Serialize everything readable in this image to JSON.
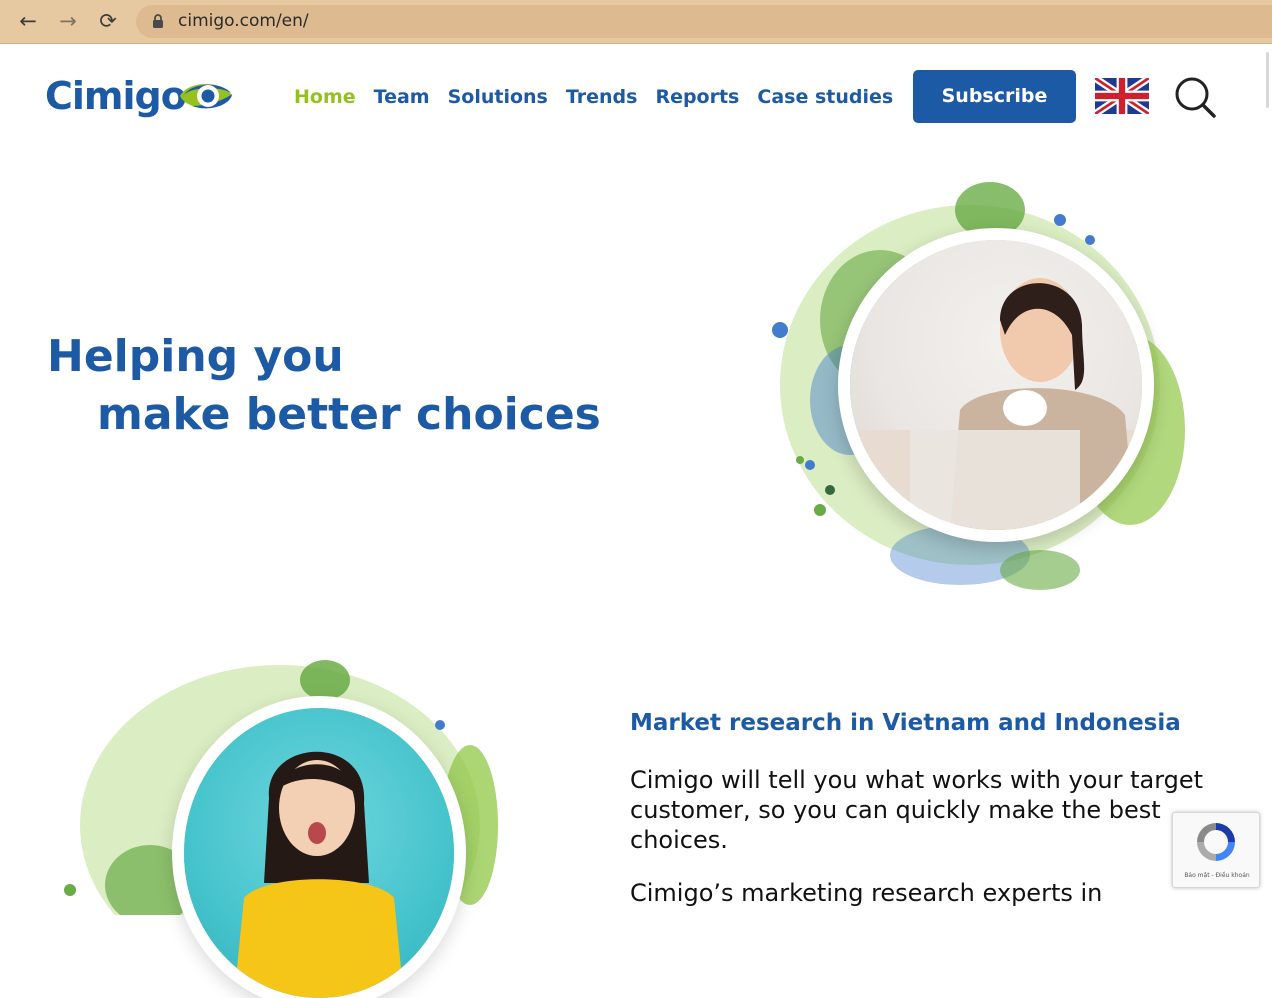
{
  "browser": {
    "url": "cimigo.com/en/",
    "icons": {
      "back": "back-arrow-icon",
      "forward": "forward-arrow-icon",
      "reload": "reload-icon",
      "lock": "lock-icon"
    }
  },
  "header": {
    "logo_text": "Cimigo",
    "nav": [
      {
        "label": "Home",
        "active": true
      },
      {
        "label": "Team",
        "active": false
      },
      {
        "label": "Solutions",
        "active": false
      },
      {
        "label": "Trends",
        "active": false
      },
      {
        "label": "Reports",
        "active": false
      },
      {
        "label": "Case studies",
        "active": false
      }
    ],
    "subscribe_label": "Subscribe",
    "language_icon": "uk-flag-icon",
    "search_icon": "search-icon"
  },
  "hero": {
    "title_line1": "Helping you",
    "title_line2": "make better choices"
  },
  "section": {
    "title": "Market research in Vietnam and Indonesia",
    "paragraph1": "Cimigo will tell you what works with your target customer, so you can quickly make the best choices.",
    "paragraph2": "Cimigo’s marketing research experts in"
  },
  "recaptcha": {
    "terms": "Bảo mật - Điều khoản"
  },
  "colors": {
    "brand_blue": "#1d5aa6",
    "brand_green": "#95c11f",
    "chrome_bar": "#e6c9a1"
  }
}
